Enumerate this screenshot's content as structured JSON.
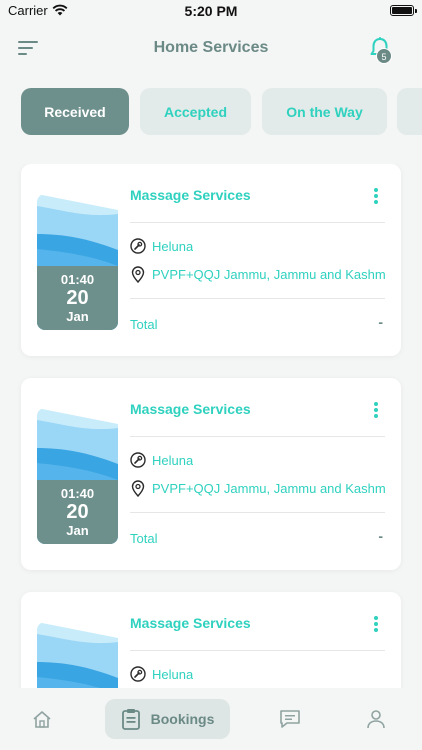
{
  "status_bar": {
    "carrier": "Carrier",
    "time": "5:20 PM"
  },
  "header": {
    "title": "Home Services",
    "notification_count": "5"
  },
  "tabs": [
    {
      "label": "Received",
      "active": true
    },
    {
      "label": "Accepted",
      "active": false
    },
    {
      "label": "On the Way",
      "active": false
    }
  ],
  "bookings": [
    {
      "service": "Massage Services",
      "provider": "Heluna",
      "address": "PVPF+QQJ Jammu, Jammu and Kashmir",
      "time": "01:40",
      "day": "20",
      "month": "Jan",
      "total_label": "Total",
      "total_value": "-"
    },
    {
      "service": "Massage Services",
      "provider": "Heluna",
      "address": "PVPF+QQJ Jammu, Jammu and Kashmir",
      "time": "01:40",
      "day": "20",
      "month": "Jan",
      "total_label": "Total",
      "total_value": "-"
    },
    {
      "service": "Massage Services",
      "provider": "Heluna"
    }
  ],
  "bottom_nav": {
    "home_icon": "home-icon",
    "bookings_label": "Bookings",
    "chat_icon": "chat-icon",
    "profile_icon": "user-icon"
  },
  "colors": {
    "primary": "#6e908c",
    "accent": "#2fd1bf",
    "tab_inactive_bg": "#e2ebe9"
  }
}
